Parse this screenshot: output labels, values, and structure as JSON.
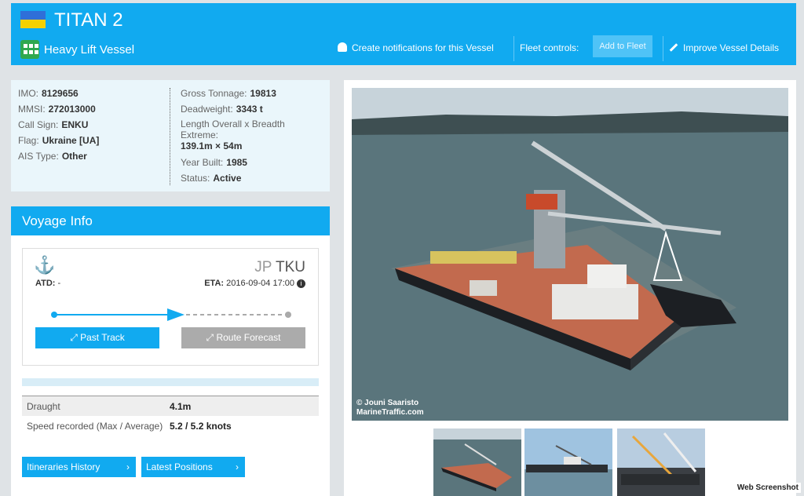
{
  "header": {
    "vessel_name": "TITAN 2",
    "vessel_type": "Heavy Lift Vessel",
    "notifications_label": "Create notifications for this Vessel",
    "fleet_controls_label": "Fleet controls:",
    "add_to_fleet_label": "Add to Fleet",
    "improve_label": "Improve Vessel Details",
    "flag_colors": [
      "#2f6fd8",
      "#f5d100"
    ]
  },
  "details": {
    "left": [
      {
        "label": "IMO:",
        "value": "8129656"
      },
      {
        "label": "MMSI:",
        "value": "272013000"
      },
      {
        "label": "Call Sign:",
        "value": "ENKU"
      },
      {
        "label": "Flag:",
        "value": "Ukraine [UA]"
      },
      {
        "label": "AIS Type:",
        "value": "Other"
      }
    ],
    "right": [
      {
        "label": "Gross Tonnage:",
        "value": "19813"
      },
      {
        "label": "Deadweight:",
        "value": "3343 t"
      },
      {
        "label": "Length Overall x Breadth Extreme:",
        "value": "139.1m × 54m"
      },
      {
        "label": "Year Built:",
        "value": "1985"
      },
      {
        "label": "Status:",
        "value": "Active"
      }
    ]
  },
  "voyage": {
    "title": "Voyage Info",
    "atd_label": "ATD:",
    "atd_value": "-",
    "dest_country": "JP",
    "dest_port": "TKU",
    "eta_label": "ETA:",
    "eta_value": "2016-09-04 17:00",
    "past_track_label": "Past Track",
    "route_forecast_label": "Route Forecast",
    "draught_label": "Draught",
    "draught_value": "4.1m",
    "speed_label": "Speed recorded (Max / Average)",
    "speed_value": "5.2 / 5.2 knots",
    "itineraries_label": "Itineraries History",
    "positions_label": "Latest Positions"
  },
  "photo": {
    "credit_line1": "© Jouni Saaristo",
    "credit_line2": "MarineTraffic.com",
    "watermark": "Web Screenshot"
  }
}
